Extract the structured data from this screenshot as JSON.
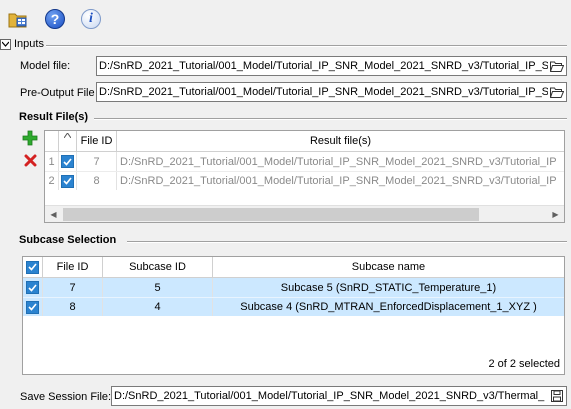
{
  "toolbar": {
    "help_glyph": "?",
    "info_glyph": "i",
    "icons": [
      "open-session-icon",
      "help-icon",
      "info-icon"
    ]
  },
  "inputs": {
    "title": "Inputs",
    "model_file_label": "Model file:",
    "model_file_value": "D:/SnRD_2021_Tutorial/001_Model/Tutorial_IP_SNR_Model_2021_SNRD_v3/Tutorial_IP_S",
    "pre_output_label": "Pre-Output File",
    "pre_output_value": "D:/SnRD_2021_Tutorial/001_Model/Tutorial_IP_SNR_Model_2021_SNRD_v3/Tutorial_IP_S"
  },
  "result_files": {
    "title": "Result File(s)",
    "columns": [
      "File ID",
      "Result file(s)"
    ],
    "rows": [
      {
        "num": "1",
        "file_id": "7",
        "path": "D:/SnRD_2021_Tutorial/001_Model/Tutorial_IP_SNR_Model_2021_SNRD_v3/Tutorial_IP"
      },
      {
        "num": "2",
        "file_id": "8",
        "path": "D:/SnRD_2021_Tutorial/001_Model/Tutorial_IP_SNR_Model_2021_SNRD_v3/Tutorial_IP"
      }
    ]
  },
  "subcase": {
    "title": "Subcase Selection",
    "columns": [
      "File ID",
      "Subcase ID",
      "Subcase name"
    ],
    "rows": [
      {
        "file_id": "7",
        "subcase_id": "5",
        "name": "Subcase 5 (SnRD_STATIC_Temperature_1)"
      },
      {
        "file_id": "8",
        "subcase_id": "4",
        "name": "Subcase 4 (SnRD_MTRAN_EnforcedDisplacement_1_XYZ )"
      }
    ],
    "status": "2 of 2 selected"
  },
  "save_session": {
    "label": "Save Session File:",
    "value": "D:/SnRD_2021_Tutorial/001_Model/Tutorial_IP_SNR_Model_2021_SNRD_v3/Thermal_"
  },
  "colors": {
    "selected_row": "#cce8ff",
    "checkbox": "#2b83d0",
    "add": "#2eaa2e",
    "remove": "#d42222"
  }
}
